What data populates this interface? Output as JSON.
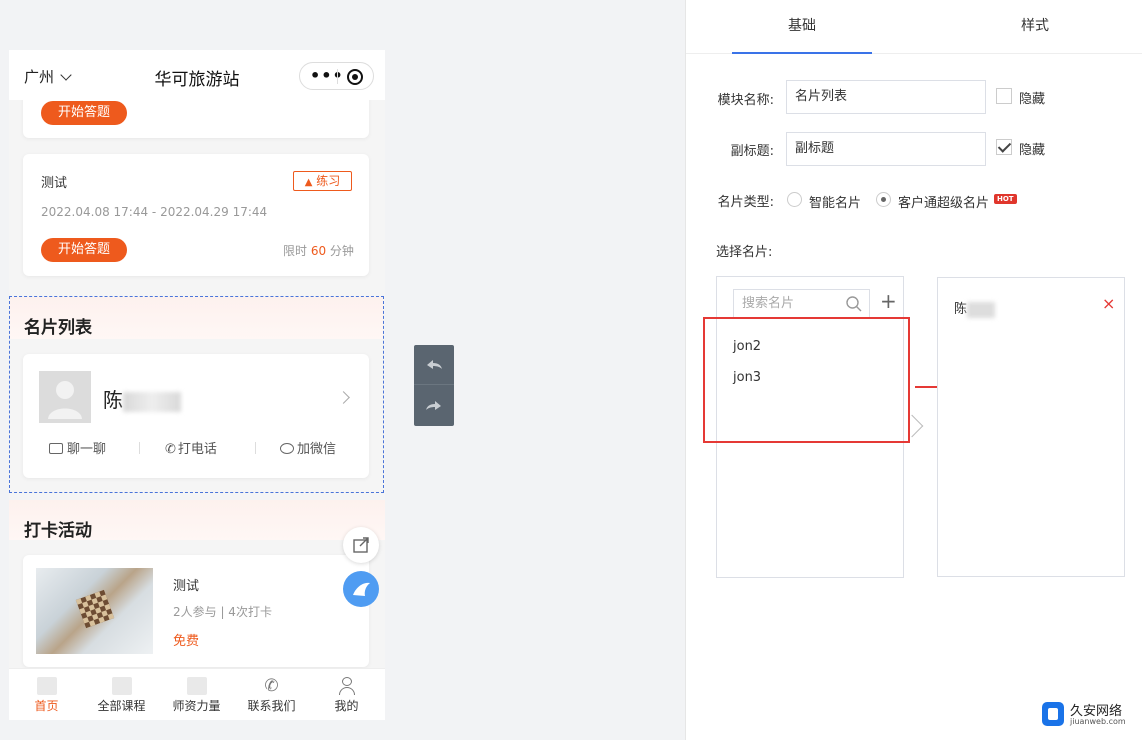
{
  "phone": {
    "city": "广州",
    "app_title": "华可旅游站",
    "quiz_prev": {
      "button": "开始答题"
    },
    "quiz_card": {
      "title": "测试",
      "badge": "练习",
      "date_range": "2022.04.08 17:44 - 2022.04.29 17:44",
      "button": "开始答题",
      "limit_prefix": "限时 ",
      "limit_value": "60",
      "limit_suffix": " 分钟"
    },
    "card_section": {
      "title": "名片列表",
      "name": "陈",
      "actions": [
        "聊一聊",
        "打电话",
        "加微信"
      ]
    },
    "checkin_section": {
      "title": "打卡活动",
      "item_title": "测试",
      "item_meta": "2人参与 | 4次打卡",
      "item_price": "免费"
    },
    "tabbar": [
      "首页",
      "全部课程",
      "师资力量",
      "联系我们",
      "我的"
    ]
  },
  "panel": {
    "tabs": [
      "基础",
      "样式"
    ],
    "module_name_label": "模块名称:",
    "module_name_value": "名片列表",
    "hide_label": "隐藏",
    "subtitle_label": "副标题:",
    "subtitle_value": "副标题",
    "card_type_label": "名片类型:",
    "card_type_options": [
      "智能名片",
      "客户通超级名片"
    ],
    "hot_badge": "HOT",
    "select_label": "选择名片:",
    "search_placeholder": "搜索名片",
    "available": [
      "jon2",
      "jon3"
    ],
    "selected": [
      "陈"
    ]
  },
  "watermark": {
    "cn": "久安网络",
    "en": "jiuanweb.com"
  },
  "colors": {
    "accent": "#ee5a1d",
    "blue": "#3a73e8",
    "red": "#e53935"
  }
}
